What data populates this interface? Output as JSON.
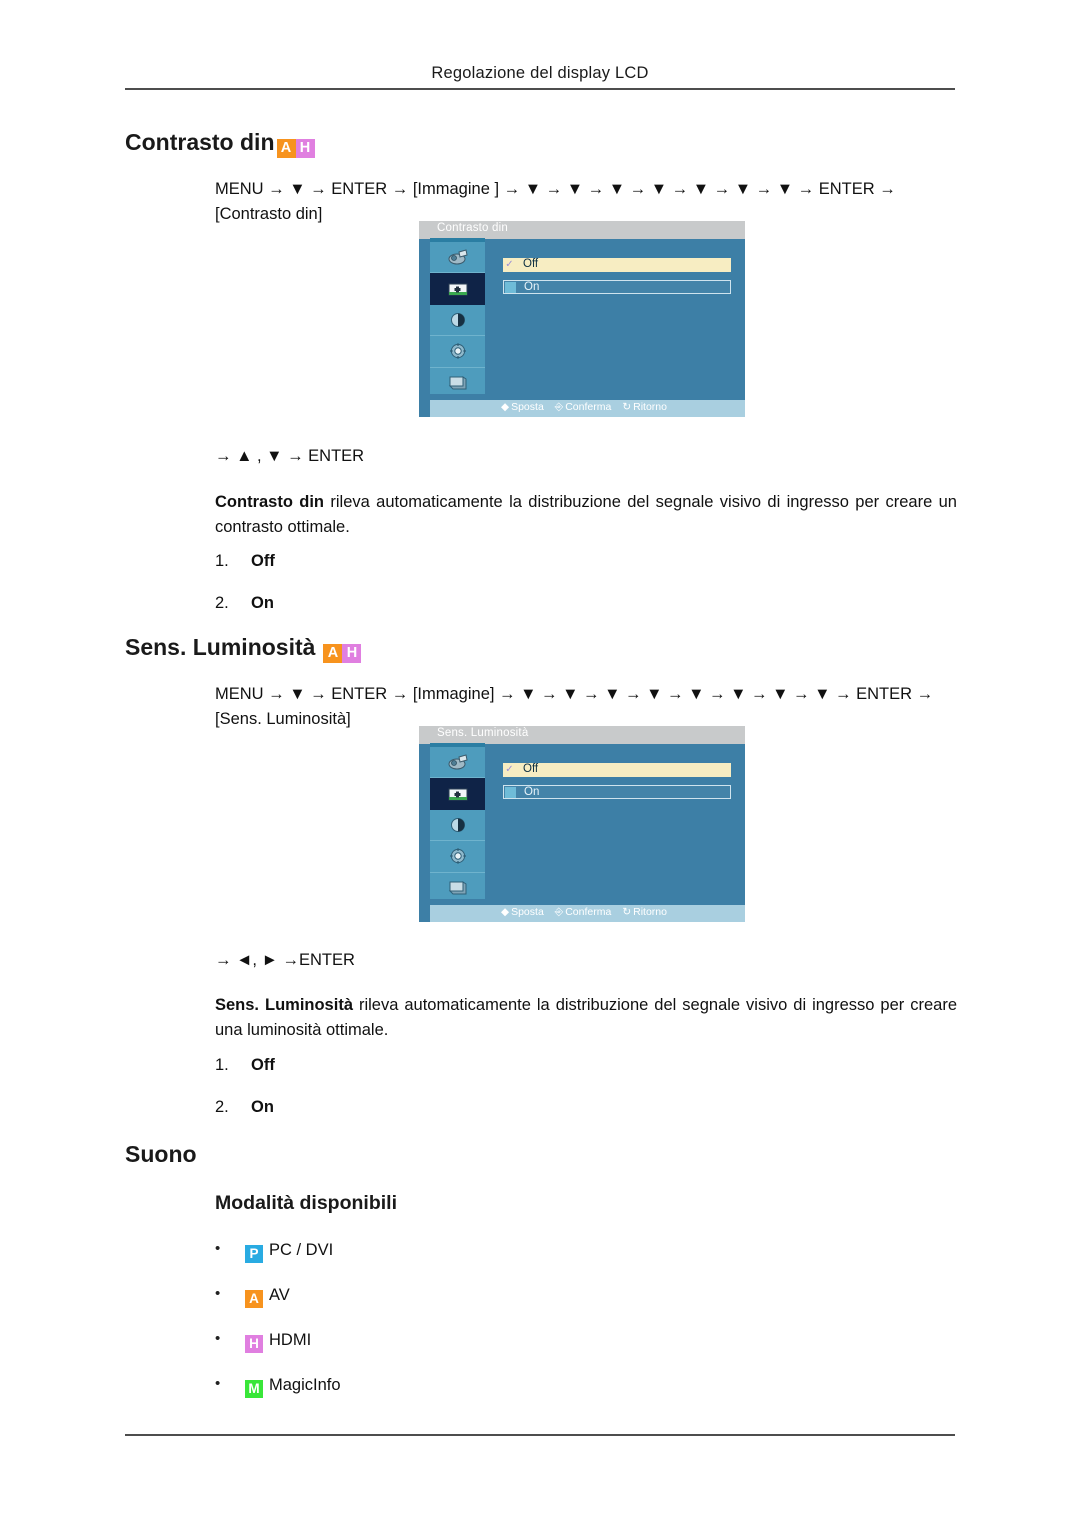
{
  "page": {
    "header": "Regolazione del display LCD"
  },
  "sections": [
    {
      "heading": "Contrasto din",
      "badges": [
        "A",
        "H"
      ],
      "menu_path": {
        "prefix": "MENU",
        "segments": [
          "MENU",
          "ENTER",
          "[Immagine ]",
          "ENTER",
          "[Contrasto din]"
        ],
        "down_arrow_count": 7,
        "full_text": "MENU → ▼ → ENTER → [Immagine ] → ▼ → ▼ → ▼ → ▼ → ▼ → ▼ → ▼ → ENTER → [Contrasto din]"
      },
      "key_hint": "→ ▲ , ▼ → ENTER",
      "description_bold": "Contrasto din",
      "description_rest": " rileva automaticamente la distribuzione del segnale visivo di ingresso per creare un contrasto ottimale.",
      "options": [
        {
          "num": "1.",
          "label": "Off"
        },
        {
          "num": "2.",
          "label": "On"
        }
      ],
      "osd": {
        "title": "Contrasto din",
        "rows": [
          {
            "label": "Off",
            "selected": true
          },
          {
            "label": "On",
            "selected": false
          }
        ],
        "footer": [
          {
            "icon": "updown-icon",
            "label": "Sposta"
          },
          {
            "icon": "enter-icon",
            "label": "Conferma"
          },
          {
            "icon": "return-icon",
            "label": "Ritorno"
          }
        ],
        "sidebar_icons": [
          "input-source-icon",
          "picture-icon",
          "contrast-icon",
          "setup-gear-icon",
          "multi-display-icon"
        ],
        "selected_sidebar_index": 1
      }
    },
    {
      "heading": "Sens. Luminosità",
      "badges": [
        "A",
        "H"
      ],
      "menu_path": {
        "prefix": "MENU",
        "segments": [
          "MENU",
          "ENTER",
          "[Immagine]",
          "ENTER",
          "[Sens. Luminosità]"
        ],
        "down_arrow_count": 8,
        "full_text": "MENU → ▼ → ENTER → [Immagine] → ▼ → ▼ → ▼ → ▼ → ▼ → ▼ → ▼ → ▼ → ENTER → [Sens. Luminosità]"
      },
      "key_hint": "→ ◄, ► →ENTER",
      "description_bold": "Sens. Luminosità",
      "description_rest": " rileva automaticamente la distribuzione del segnale visivo di ingresso per creare una luminosità ottimale.",
      "options": [
        {
          "num": "1.",
          "label": "Off"
        },
        {
          "num": "2.",
          "label": "On"
        }
      ],
      "osd": {
        "title": "Sens. Luminosità",
        "rows": [
          {
            "label": "Off",
            "selected": true
          },
          {
            "label": "On",
            "selected": false
          }
        ],
        "footer": [
          {
            "icon": "updown-icon",
            "label": "Sposta"
          },
          {
            "icon": "enter-icon",
            "label": "Conferma"
          },
          {
            "icon": "return-icon",
            "label": "Ritorno"
          }
        ],
        "sidebar_icons": [
          "input-source-icon",
          "picture-icon",
          "contrast-icon",
          "setup-gear-icon",
          "multi-display-icon"
        ],
        "selected_sidebar_index": 1
      }
    }
  ],
  "suono": {
    "heading": "Suono",
    "subheading": "Modalità disponibili",
    "modes": [
      {
        "badge": "P",
        "color": "#29abe2",
        "label": "PC / DVI"
      },
      {
        "badge": "A",
        "color": "#f7931e",
        "label": "AV"
      },
      {
        "badge": "H",
        "color": "#e07fe0",
        "label": "HDMI"
      },
      {
        "badge": "M",
        "color": "#39e639",
        "label": "MagicInfo"
      }
    ]
  },
  "badge_colors": {
    "P": "#29abe2",
    "A": "#f7931e",
    "H": "#e07fe0",
    "M": "#39e639"
  }
}
